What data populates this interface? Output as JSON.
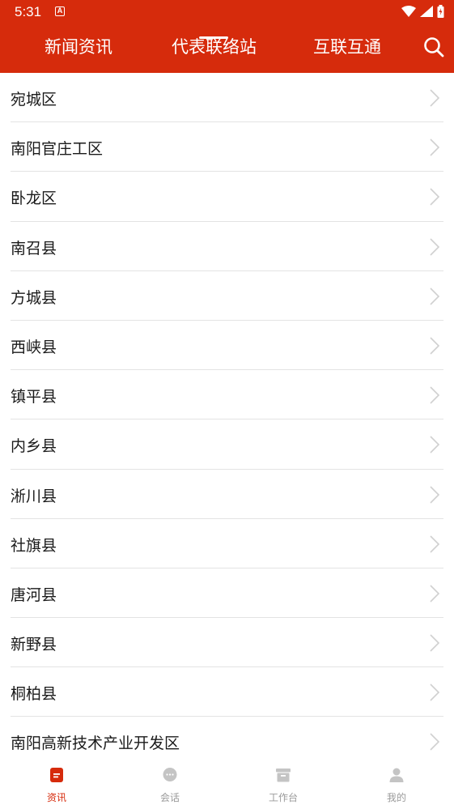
{
  "status_bar": {
    "time": "5:31",
    "notification_icon": "A"
  },
  "header": {
    "tabs": [
      {
        "label": "新闻资讯",
        "active": false
      },
      {
        "label": "代表联络站",
        "active": true
      },
      {
        "label": "互联互通",
        "active": false
      }
    ],
    "search_icon": "search-icon"
  },
  "districts": [
    "宛城区",
    "南阳官庄工区",
    "卧龙区",
    "南召县",
    "方城县",
    "西峡县",
    "镇平县",
    "内乡县",
    "淅川县",
    "社旗县",
    "唐河县",
    "新野县",
    "桐柏县",
    "南阳高新技术产业开发区"
  ],
  "bottom_nav": [
    {
      "label": "资讯",
      "icon": "news-icon",
      "active": true
    },
    {
      "label": "会话",
      "icon": "chat-icon",
      "active": false
    },
    {
      "label": "工作台",
      "icon": "workbench-icon",
      "active": false
    },
    {
      "label": "我的",
      "icon": "profile-icon",
      "active": false
    }
  ],
  "colors": {
    "brand": "#d62b0c",
    "inactive": "#9a9a9a",
    "divider": "#e3e3e3"
  }
}
